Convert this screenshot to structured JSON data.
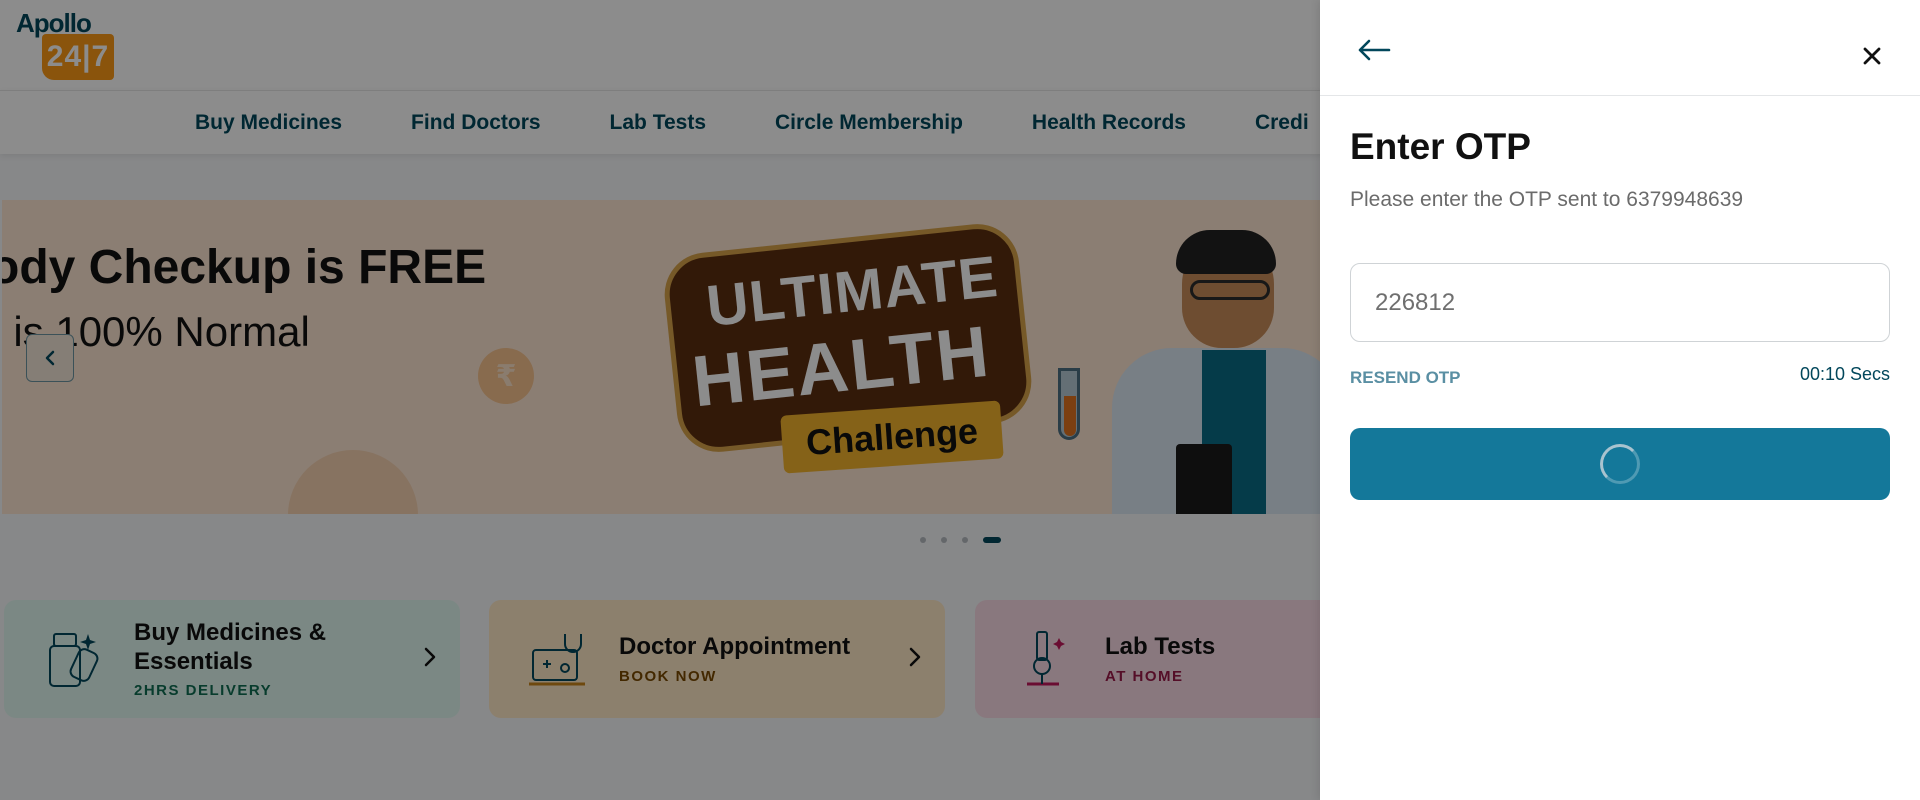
{
  "header": {
    "logo": {
      "word": "Apollo",
      "badge": "24|7"
    },
    "nav": [
      "Buy Medicines",
      "Find Doctors",
      "Lab Tests",
      "Circle Membership",
      "Health Records",
      "Credi"
    ]
  },
  "banner": {
    "headline": "ody Checkup is FREE",
    "subline": "t is 100% Normal",
    "badge_line1": "ULTIMATE",
    "badge_line2": "HEALTH",
    "badge_pill": "Challenge",
    "coin_symbol": "₹",
    "prev_icon": "chevron-left",
    "carousel_total": 4,
    "carousel_active": 4
  },
  "cards": [
    {
      "title": "Buy Medicines & Essentials",
      "subtitle": "2HRS DELIVERY",
      "icon": "medicine-bottle-icon"
    },
    {
      "title": "Doctor Appointment",
      "subtitle": "BOOK NOW",
      "icon": "doctor-laptop-icon"
    },
    {
      "title": "Lab Tests",
      "subtitle": "AT HOME",
      "icon": "microscope-icon"
    }
  ],
  "otp": {
    "title": "Enter OTP",
    "description": "Please enter the OTP sent to 6379948639",
    "input_value": "226812",
    "resend_label": "RESEND OTP",
    "timer": "00:10 Secs",
    "submit_state": "loading"
  },
  "colors": {
    "brand": "#02475b",
    "button": "#14789a",
    "logo_orange": "#fc9916",
    "resend": "#5a8fa3"
  }
}
